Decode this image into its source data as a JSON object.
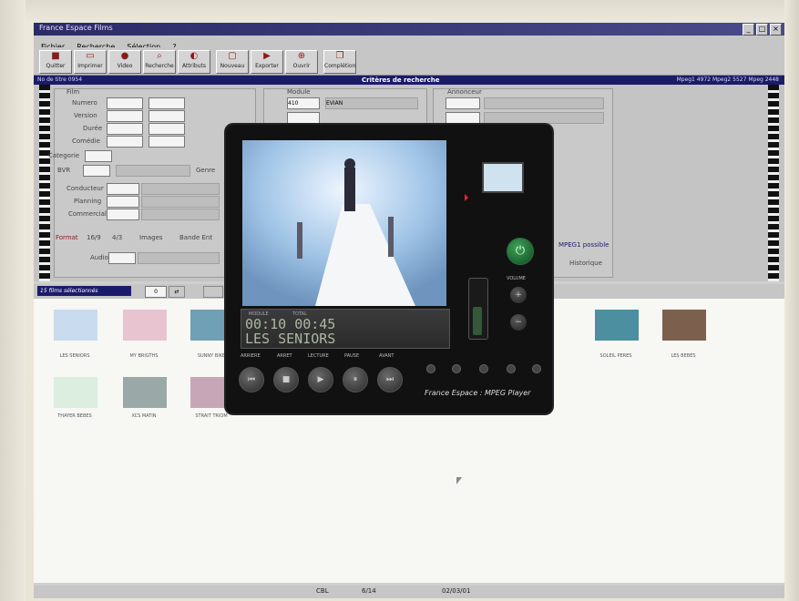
{
  "window": {
    "title": "France Espace Films"
  },
  "menu": [
    "Fichier",
    "Recherche",
    "Sélection",
    "?"
  ],
  "toolbar": [
    {
      "label": "Quitter",
      "icon": "exit-icon"
    },
    {
      "label": "Imprimer",
      "icon": "print-icon"
    },
    {
      "label": "Video",
      "icon": "video-icon"
    },
    {
      "label": "Recherche",
      "icon": "search-icon"
    },
    {
      "label": "Attributs",
      "icon": "attributes-icon"
    },
    {
      "label": "Nouveau",
      "icon": "new-icon"
    },
    {
      "label": "Exporter",
      "icon": "export-icon"
    },
    {
      "label": "Ouvrir",
      "icon": "open-icon"
    },
    {
      "label": "Complétion",
      "icon": "completion-icon"
    }
  ],
  "header_bar": {
    "left": "No de titre   0954",
    "center": "Critères de recherche",
    "right": "Mpeg1 4972   Mpeg2 5527   Mpeg 2448"
  },
  "form": {
    "labels": {
      "film": "Film",
      "numero": "Numero",
      "version": "Version",
      "duree": "Durée",
      "comedie": "Comédie",
      "categorie": "Categorie",
      "bvr": "BVR",
      "genre": "Genre",
      "conducteur": "Conducteur",
      "planning": "Planning",
      "commercial": "Commercial",
      "format": "Format",
      "f169": "16/9",
      "f43": "4/3",
      "image": "Images",
      "bande": "Bande Ent",
      "audio": "Audio",
      "module": "Module",
      "annonce": "Annonceur",
      "mpeg_possible": "MPEG1 possible",
      "historique": "Historique"
    },
    "module_value": "410",
    "module_name": "EVIAN"
  },
  "selection": {
    "label": "15 films sélectionnés",
    "count": "0"
  },
  "thumbnails": [
    {
      "caption": "LES SENIORS",
      "color": "#c9dcef"
    },
    {
      "caption": "MY BRIGTHS",
      "color": "#e7c4cf"
    },
    {
      "caption": "SUNNY BIKE",
      "color": "#6fa0b5"
    },
    {
      "caption": "SOLEIL PERES",
      "color": "#4c8fa0"
    },
    {
      "caption": "LES BEBES",
      "color": "#7c5f4d"
    },
    {
      "caption": "THAYER BEBES",
      "color": "#dceee0"
    },
    {
      "caption": "XCS MATIN",
      "color": "#9aa9a8"
    },
    {
      "caption": "STRAIT TRIOM",
      "color": "#c7a6b7"
    }
  ],
  "status": {
    "left": "CBL",
    "mid": "6/14",
    "date": "02/03/01"
  },
  "player": {
    "header_left": "MODULE",
    "header_right": "TOTAL",
    "time_elapsed": "00:10",
    "time_total": "00:45",
    "title": "LES SENIORS",
    "controls": [
      "ARRIERE",
      "ARRET",
      "LECTURE",
      "PAUSE",
      "AVANT"
    ],
    "volume_label": "VOLUME",
    "brand": "France Espace : MPEG Player",
    "power_icon": "power-icon",
    "volume_level": 0.55
  }
}
